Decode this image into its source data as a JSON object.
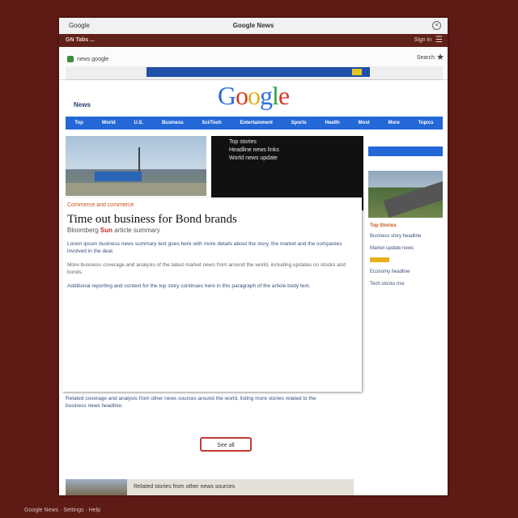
{
  "titlebar": {
    "title": "Google News",
    "left": "Google"
  },
  "navbar": {
    "left": "GN  Tabs  ...",
    "right": "Sign in"
  },
  "addrbar": {
    "text": "news google",
    "right": "Search"
  },
  "logo": {
    "G": "G",
    "o1": "o",
    "o2": "o",
    "g": "g",
    "l": "l",
    "e": "e"
  },
  "sublogo": "News",
  "nav_items": [
    "Top",
    "World",
    "U.S.",
    "Business",
    "Sci/Tech",
    "Entertainment",
    "Sports",
    "Health",
    "Most",
    "More",
    "Topics"
  ],
  "darkbox": [
    "Top stories",
    "Headline news links",
    "World news update"
  ],
  "article": {
    "sub": "Commerce and commerce",
    "headline": "Time out business for Bond brands",
    "byline_pre": "Bloomberg",
    "byline_red": "Sun",
    "byline_post": "article summary",
    "p1": "Lorem ipsum business news summary text goes here with more details about the story, the market and the companies involved in the deal.",
    "p2": "More business coverage and analysis of the latest market news from around the world, including updates on stocks and bonds.",
    "p3": "Additional reporting and context for the top story continues here in this paragraph of the article body text."
  },
  "lower": "Related coverage and analysis from other news sources around the world, listing more stories related to the business news headline.",
  "redbtn": "See all",
  "right_col": {
    "header": "Top Stories",
    "items": [
      "Business story headline",
      "Market update news",
      "Economy headline",
      "Tech stocks rise"
    ]
  },
  "bottom_strip": "Related stories from other news sources",
  "footer": "Google News · Settings · Help",
  "colors": {
    "background": "#5e1a15",
    "nav": "#2467d6",
    "accent_red": "#c43a31"
  }
}
